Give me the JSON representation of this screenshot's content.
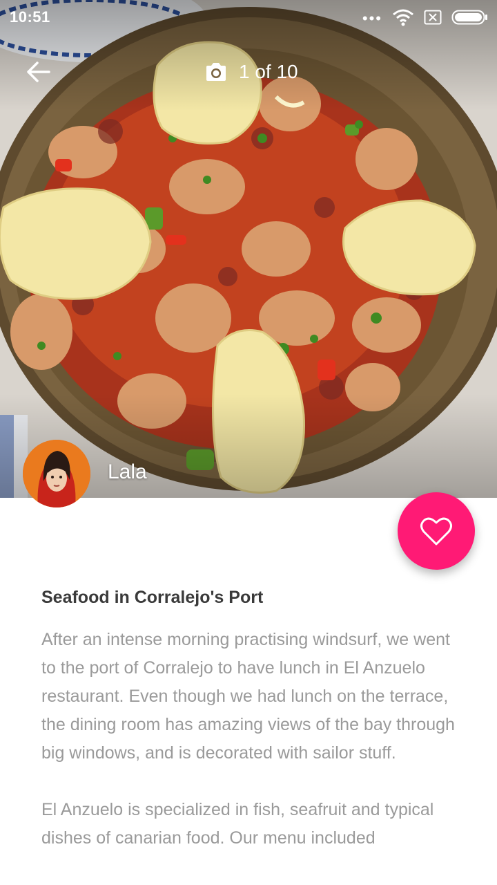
{
  "status_bar": {
    "time": "10:51",
    "icons": [
      "more-dots-icon",
      "wifi-icon",
      "no-sim-icon",
      "battery-icon"
    ]
  },
  "toolbar": {
    "back_icon": "arrow-left-icon",
    "camera_icon": "camera-icon",
    "photo_counter": "1 of 10"
  },
  "author": {
    "name": "Lala",
    "avatar_icon": "avatar"
  },
  "favorite": {
    "icon": "heart-outline-icon",
    "color": "#ff1a75"
  },
  "post": {
    "title": "Seafood in Corralejo's Port",
    "paragraphs": [
      "After an intense morning practising windsurf, we went to the port of Corralejo to have lunch in El Anzuelo restaurant. Even though we had lunch on the terrace, the dining room has amazing views of the bay through big windows, and is decorated with sailor stuff.",
      "El Anzuelo is specialized in fish, seafruit and typical dishes of canarian food. Our menu included"
    ]
  }
}
